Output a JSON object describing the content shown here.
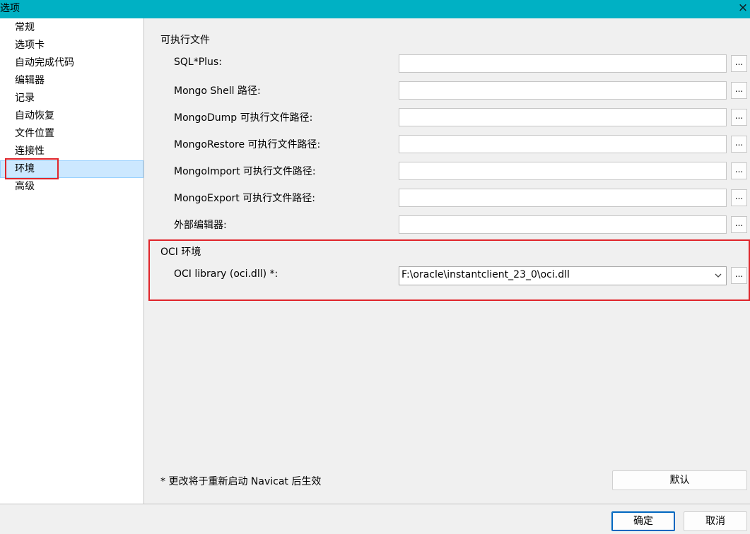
{
  "window": {
    "title": "选项",
    "close_icon": "×"
  },
  "sidebar": {
    "items": [
      {
        "label": "常规"
      },
      {
        "label": "选项卡"
      },
      {
        "label": "自动完成代码"
      },
      {
        "label": "编辑器"
      },
      {
        "label": "记录"
      },
      {
        "label": "自动恢复"
      },
      {
        "label": "文件位置"
      },
      {
        "label": "连接性"
      },
      {
        "label": "环境",
        "selected": true
      },
      {
        "label": "高级"
      }
    ]
  },
  "executables": {
    "title": "可执行文件",
    "fields": [
      {
        "label": "SQL*Plus:",
        "value": "",
        "browse": "..."
      },
      {
        "label": "Mongo Shell 路径:",
        "value": "",
        "browse": "..."
      },
      {
        "label": "MongoDump 可执行文件路径:",
        "value": "",
        "browse": "..."
      },
      {
        "label": "MongoRestore 可执行文件路径:",
        "value": "",
        "browse": "..."
      },
      {
        "label": "MongoImport 可执行文件路径:",
        "value": "",
        "browse": "..."
      },
      {
        "label": "MongoExport 可执行文件路径:",
        "value": "",
        "browse": "..."
      },
      {
        "label": "外部编辑器:",
        "value": "",
        "browse": "..."
      }
    ]
  },
  "oci": {
    "title": "OCI 环境",
    "label": "OCI library (oci.dll) *:",
    "value": "F:\\oracle\\instantclient_23_0\\oci.dll",
    "browse": "..."
  },
  "note": "* 更改将于重新启动 Navicat 后生效",
  "buttons": {
    "default": "默认",
    "ok": "确定",
    "cancel": "取消"
  },
  "colors": {
    "titlebar": "#00b1c4",
    "highlight": "#e0252b",
    "selection": "#cce8ff"
  }
}
